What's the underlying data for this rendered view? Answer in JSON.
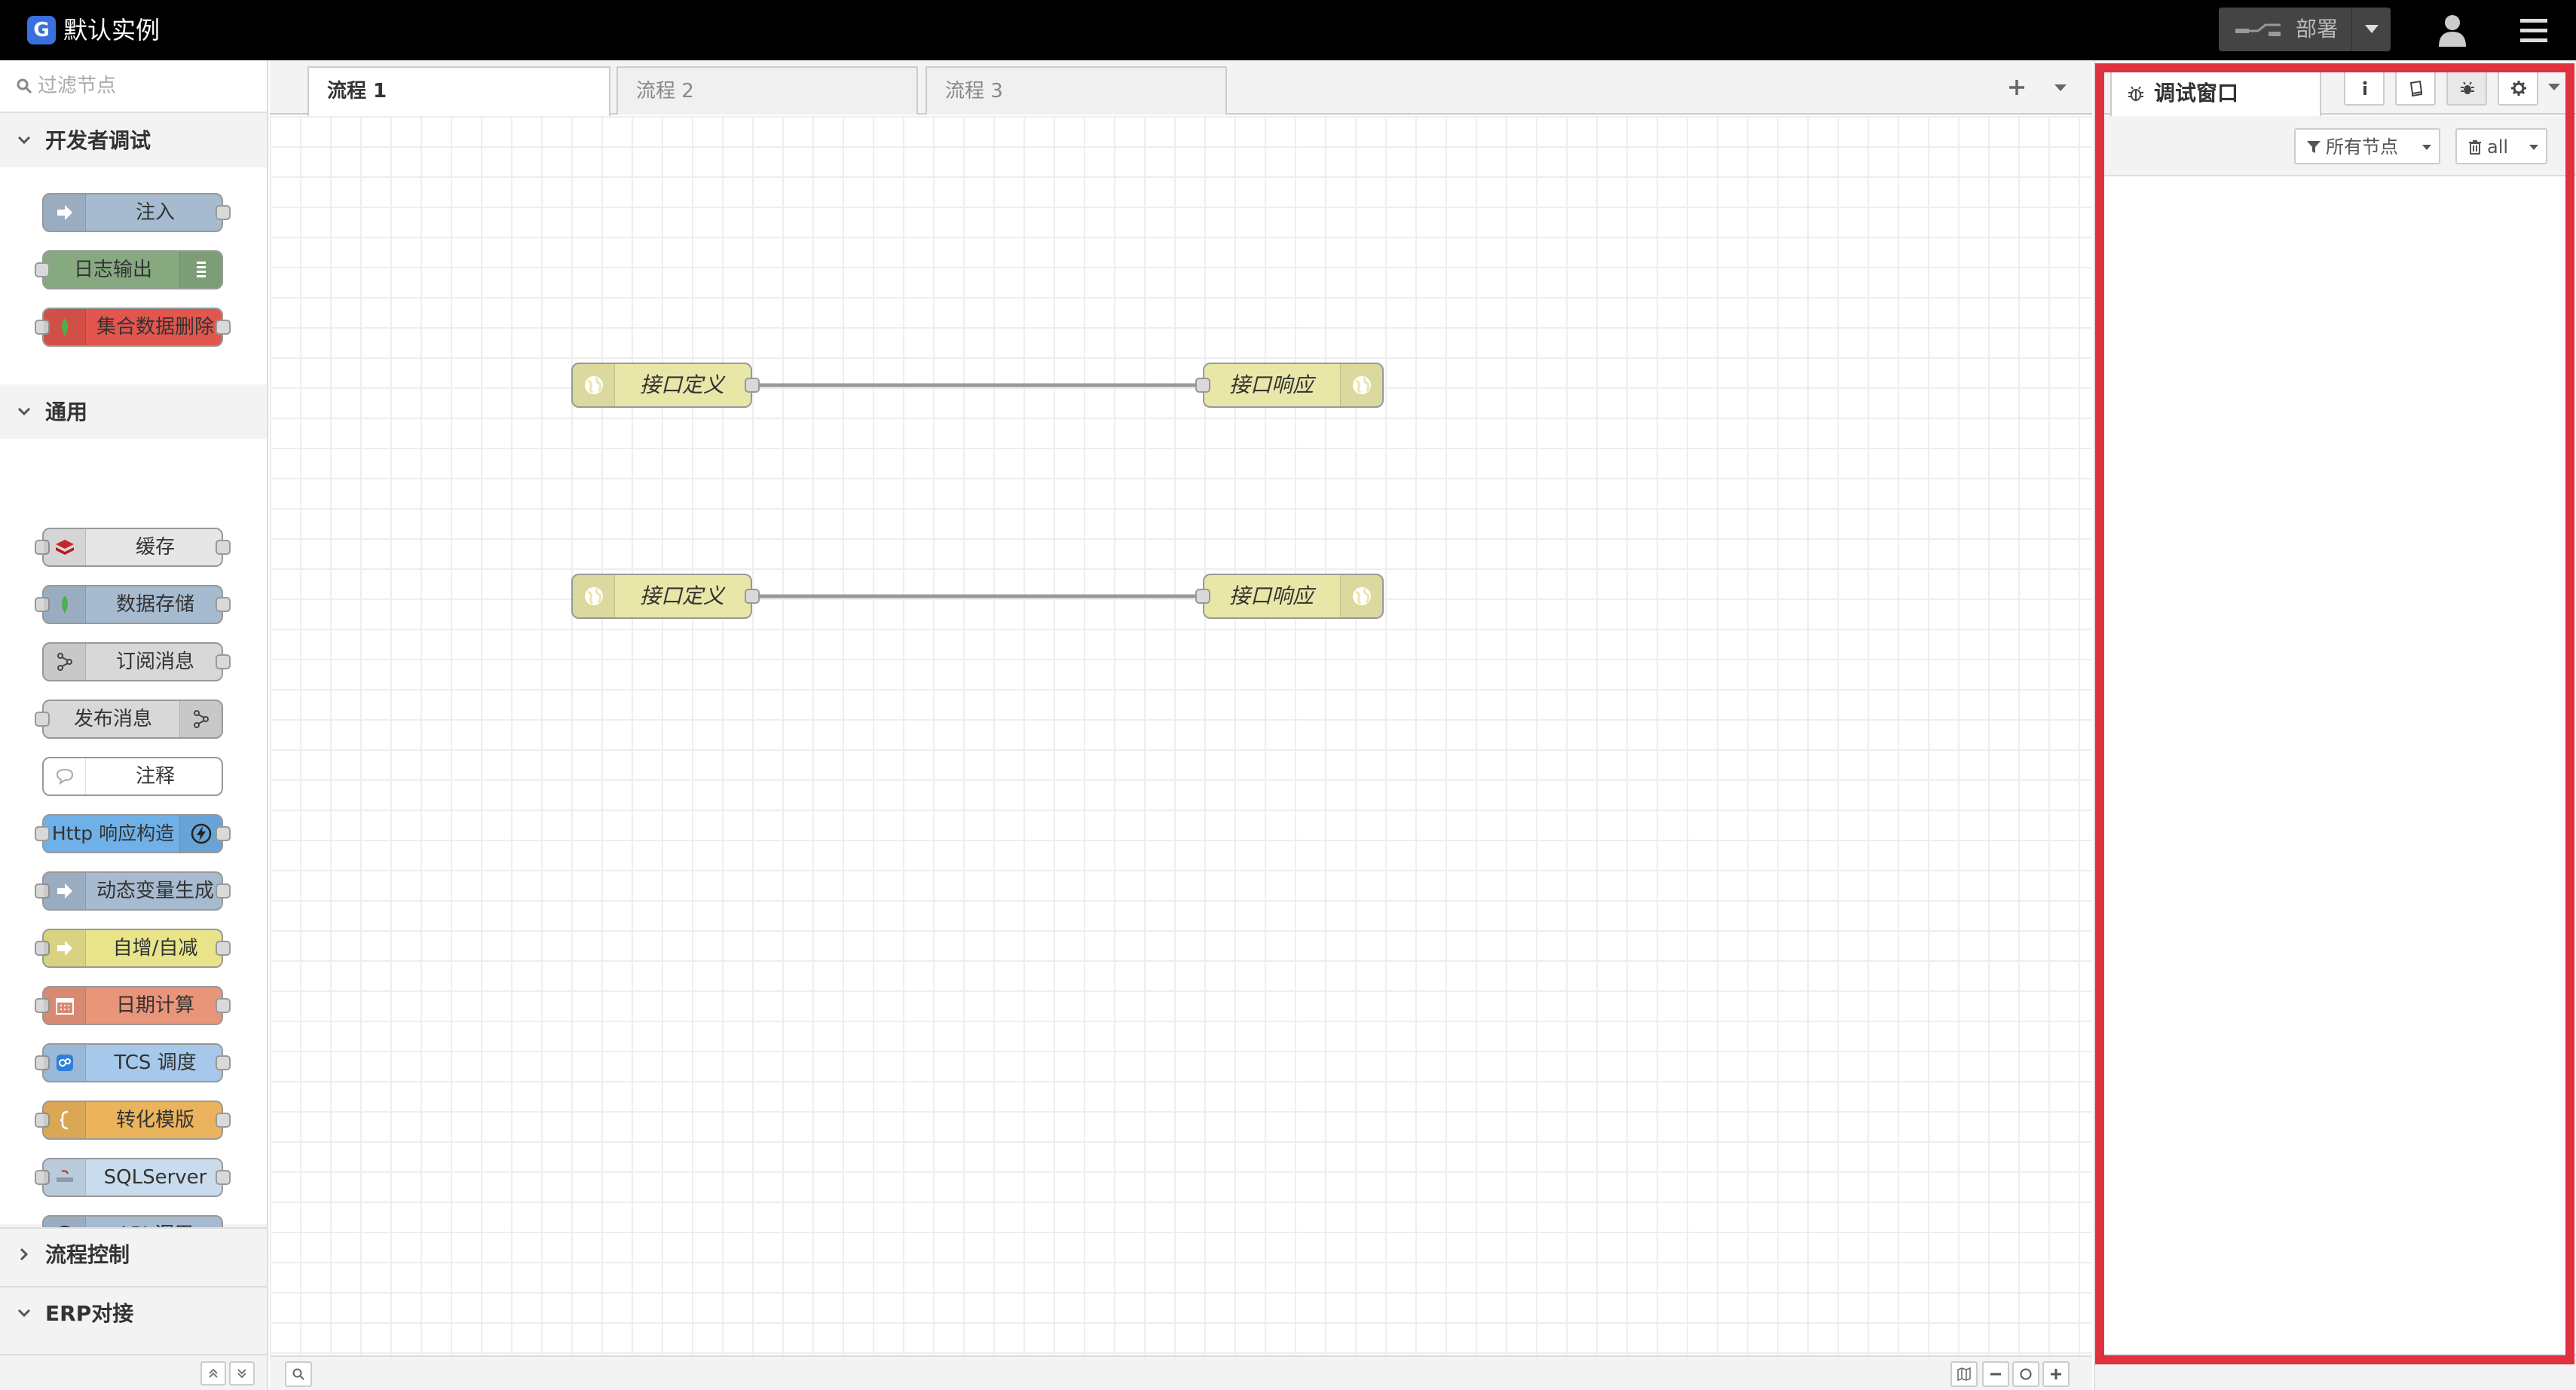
{
  "header": {
    "logo_glyph": "G",
    "title": "默认实例",
    "deploy_label": "部署",
    "colors": {
      "background": "#000000",
      "deploy": "#444444",
      "logo": "#3a6fe0"
    }
  },
  "palette": {
    "search_placeholder": "过滤节点",
    "categories": [
      {
        "label": "开发者调试",
        "expanded": true,
        "nodes": [
          {
            "label": "注入",
            "color": "#a6bbcf",
            "icon": "arrow-right-icon"
          },
          {
            "label": "日志输出",
            "color": "#87a980",
            "icon": "list-icon"
          },
          {
            "label": "集合数据删除",
            "color": "#e2564e",
            "icon": "leaf-icon"
          }
        ]
      },
      {
        "label": "通用",
        "expanded": true,
        "nodes": [
          {
            "label": "缓存",
            "color": "#e6e6e6",
            "icon": "redis-icon"
          },
          {
            "label": "数据存储",
            "color": "#a6bbcf",
            "icon": "leaf-icon"
          },
          {
            "label": "订阅消息",
            "color": "#d8d8d8",
            "icon": "subscribe-icon"
          },
          {
            "label": "发布消息",
            "color": "#d8d8d8",
            "icon": "publish-icon"
          },
          {
            "label": "注释",
            "color": "#ffffff",
            "icon": "comment-icon"
          },
          {
            "label": "Http 响应构造",
            "color": "#6fb0e8",
            "icon": "lightning-icon"
          },
          {
            "label": "动态变量生成",
            "color": "#a6bbcf",
            "icon": "arrow-right-icon"
          },
          {
            "label": "自增/自减",
            "color": "#e8e48a",
            "icon": "arrow-right-icon"
          },
          {
            "label": "日期计算",
            "color": "#e8957a",
            "icon": "calendar-icon"
          },
          {
            "label": "TCS 调度",
            "color": "#a6c8ea",
            "icon": "tcs-icon"
          },
          {
            "label": "转化模版",
            "color": "#ebb45c",
            "icon": "brace-icon"
          },
          {
            "label": "SQLServer",
            "color": "#c9dced",
            "icon": "sqlserver-icon"
          },
          {
            "label": "API 调用",
            "color": "#a6bbcf",
            "icon": "api-icon"
          }
        ]
      },
      {
        "label": "流程控制",
        "expanded": false,
        "nodes": []
      },
      {
        "label": "ERP对接",
        "expanded": false,
        "nodes": []
      }
    ]
  },
  "workspace": {
    "tabs": [
      {
        "label": "流程 1",
        "active": true
      },
      {
        "label": "流程 2",
        "active": false
      },
      {
        "label": "流程 3",
        "active": false
      }
    ],
    "flow_nodes": [
      {
        "label": "接口定义",
        "type": "http-in",
        "color": "#e9e7a8"
      },
      {
        "label": "接口响应",
        "type": "http-response",
        "color": "#e9e7a8"
      },
      {
        "label": "接口定义",
        "type": "http-in",
        "color": "#e9e7a8"
      },
      {
        "label": "接口响应",
        "type": "http-response",
        "color": "#e9e7a8"
      }
    ]
  },
  "sidebar": {
    "active_tab": "调试窗口",
    "filter_label": "所有节点",
    "clear_label": "all",
    "highlight_color": "#e0313e"
  }
}
